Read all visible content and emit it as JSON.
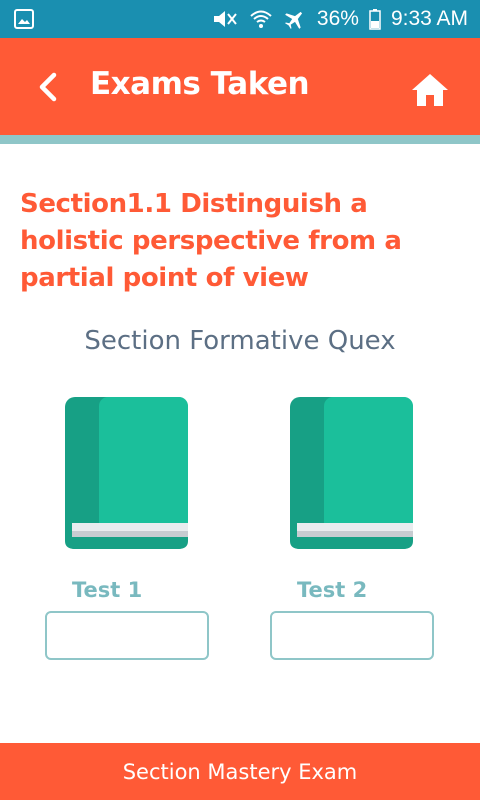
{
  "status_bar": {
    "battery": "36%",
    "time": "9:33 AM"
  },
  "app_bar": {
    "title": "Exams Taken"
  },
  "section": {
    "title": "Section1.1 Distinguish a holistic perspective from a partial point of view",
    "subtitle": "Section Formative Quex"
  },
  "tests": [
    {
      "label": "Test 1",
      "score": ""
    },
    {
      "label": "Test 2",
      "score": ""
    }
  ],
  "footer": {
    "button_label": "Section Mastery Exam"
  },
  "colors": {
    "status_bar": "#1a8fb0",
    "accent": "#ff5a36",
    "teal": "#1bbf9b",
    "teal_dark": "#17a085",
    "stripe": "#8fc6c8"
  }
}
